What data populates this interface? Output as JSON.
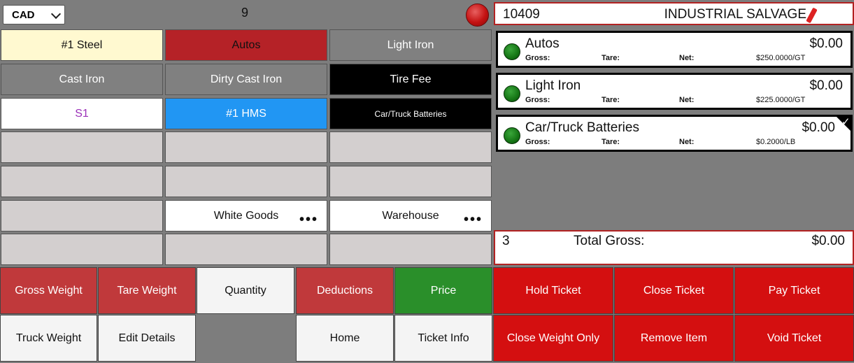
{
  "header": {
    "currency": "CAD",
    "counter": "9",
    "ticket_number": "10409",
    "customer_name": "INDUSTRIAL SALVAGE"
  },
  "colors": {
    "accent_red": "#b22222",
    "status_red": "#c41212",
    "status_green": "#157515",
    "selected_blue": "#2196f3"
  },
  "commodities": [
    [
      "#1 Steel",
      "Autos",
      "Light Iron"
    ],
    [
      "Cast Iron",
      "Dirty Cast Iron",
      "Tire Fee"
    ],
    [
      "S1",
      "#1 HMS",
      "Car/Truck Batteries"
    ],
    [
      "",
      "",
      ""
    ],
    [
      "",
      "",
      ""
    ],
    [
      "",
      "White Goods",
      "Warehouse"
    ],
    [
      "",
      "",
      ""
    ]
  ],
  "more_glyph": "•••",
  "line_items": [
    {
      "name": "Autos",
      "amount": "$0.00",
      "gross": "Gross:",
      "tare": "Tare:",
      "net": "Net:",
      "rate": "$250.0000/GT"
    },
    {
      "name": "Light Iron",
      "amount": "$0.00",
      "gross": "Gross:",
      "tare": "Tare:",
      "net": "Net:",
      "rate": "$225.0000/GT"
    },
    {
      "name": "Car/Truck Batteries",
      "amount": "$0.00",
      "gross": "Gross:",
      "tare": "Tare:",
      "net": "Net:",
      "rate": "$0.2000/LB",
      "selected": true
    }
  ],
  "check_glyph": "✓",
  "total": {
    "count": "3",
    "label": "Total Gross:",
    "value": "$0.00"
  },
  "actions": {
    "gross_weight": "Gross Weight",
    "tare_weight": "Tare Weight",
    "quantity": "Quantity",
    "deductions": "Deductions",
    "price": "Price",
    "hold_ticket": "Hold Ticket",
    "close_ticket": "Close Ticket",
    "pay_ticket": "Pay Ticket",
    "truck_weight": "Truck Weight",
    "edit_details": "Edit Details",
    "home": "Home",
    "ticket_info": "Ticket Info",
    "close_weight_only": "Close Weight Only",
    "remove_item": "Remove Item",
    "void_ticket": "Void Ticket"
  }
}
